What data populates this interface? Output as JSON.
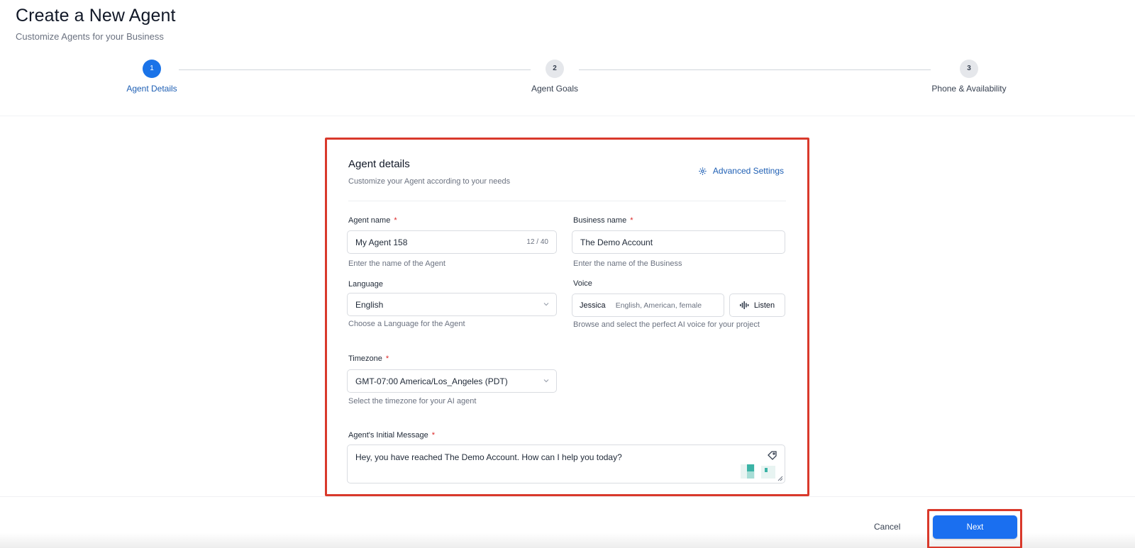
{
  "header": {
    "title": "Create a New Agent",
    "subtitle": "Customize Agents for your Business"
  },
  "stepper": {
    "steps": [
      {
        "number": "1",
        "label": "Agent Details",
        "state": "active"
      },
      {
        "number": "2",
        "label": "Agent Goals",
        "state": "inactive"
      },
      {
        "number": "3",
        "label": "Phone & Availability",
        "state": "inactive"
      }
    ]
  },
  "form": {
    "title": "Agent details",
    "subtitle": "Customize your Agent according to your needs",
    "advanced_settings_label": "Advanced Settings",
    "agent_name": {
      "label": "Agent name",
      "value": "My Agent 158",
      "counter": "12 / 40",
      "help": "Enter the name of the Agent"
    },
    "business_name": {
      "label": "Business name",
      "value": "The Demo Account",
      "help": "Enter the name of the Business"
    },
    "language": {
      "label": "Language",
      "value": "English",
      "help": "Choose a Language for the Agent"
    },
    "voice": {
      "label": "Voice",
      "name": "Jessica",
      "description": "English, American, female",
      "listen_label": "Listen",
      "help": "Browse and select the perfect AI voice for your project"
    },
    "timezone": {
      "label": "Timezone",
      "value": "GMT-07:00 America/Los_Angeles (PDT)",
      "help": "Select the timezone for your AI agent"
    },
    "initial_message": {
      "label": "Agent's Initial Message",
      "value": "Hey, you have reached The Demo Account. How can I help you today?"
    },
    "required_marker": "*"
  },
  "footer": {
    "cancel_label": "Cancel",
    "next_label": "Next"
  },
  "colors": {
    "primary": "#1a6ff0",
    "highlight": "#d9392b",
    "required": "#dc2626"
  }
}
